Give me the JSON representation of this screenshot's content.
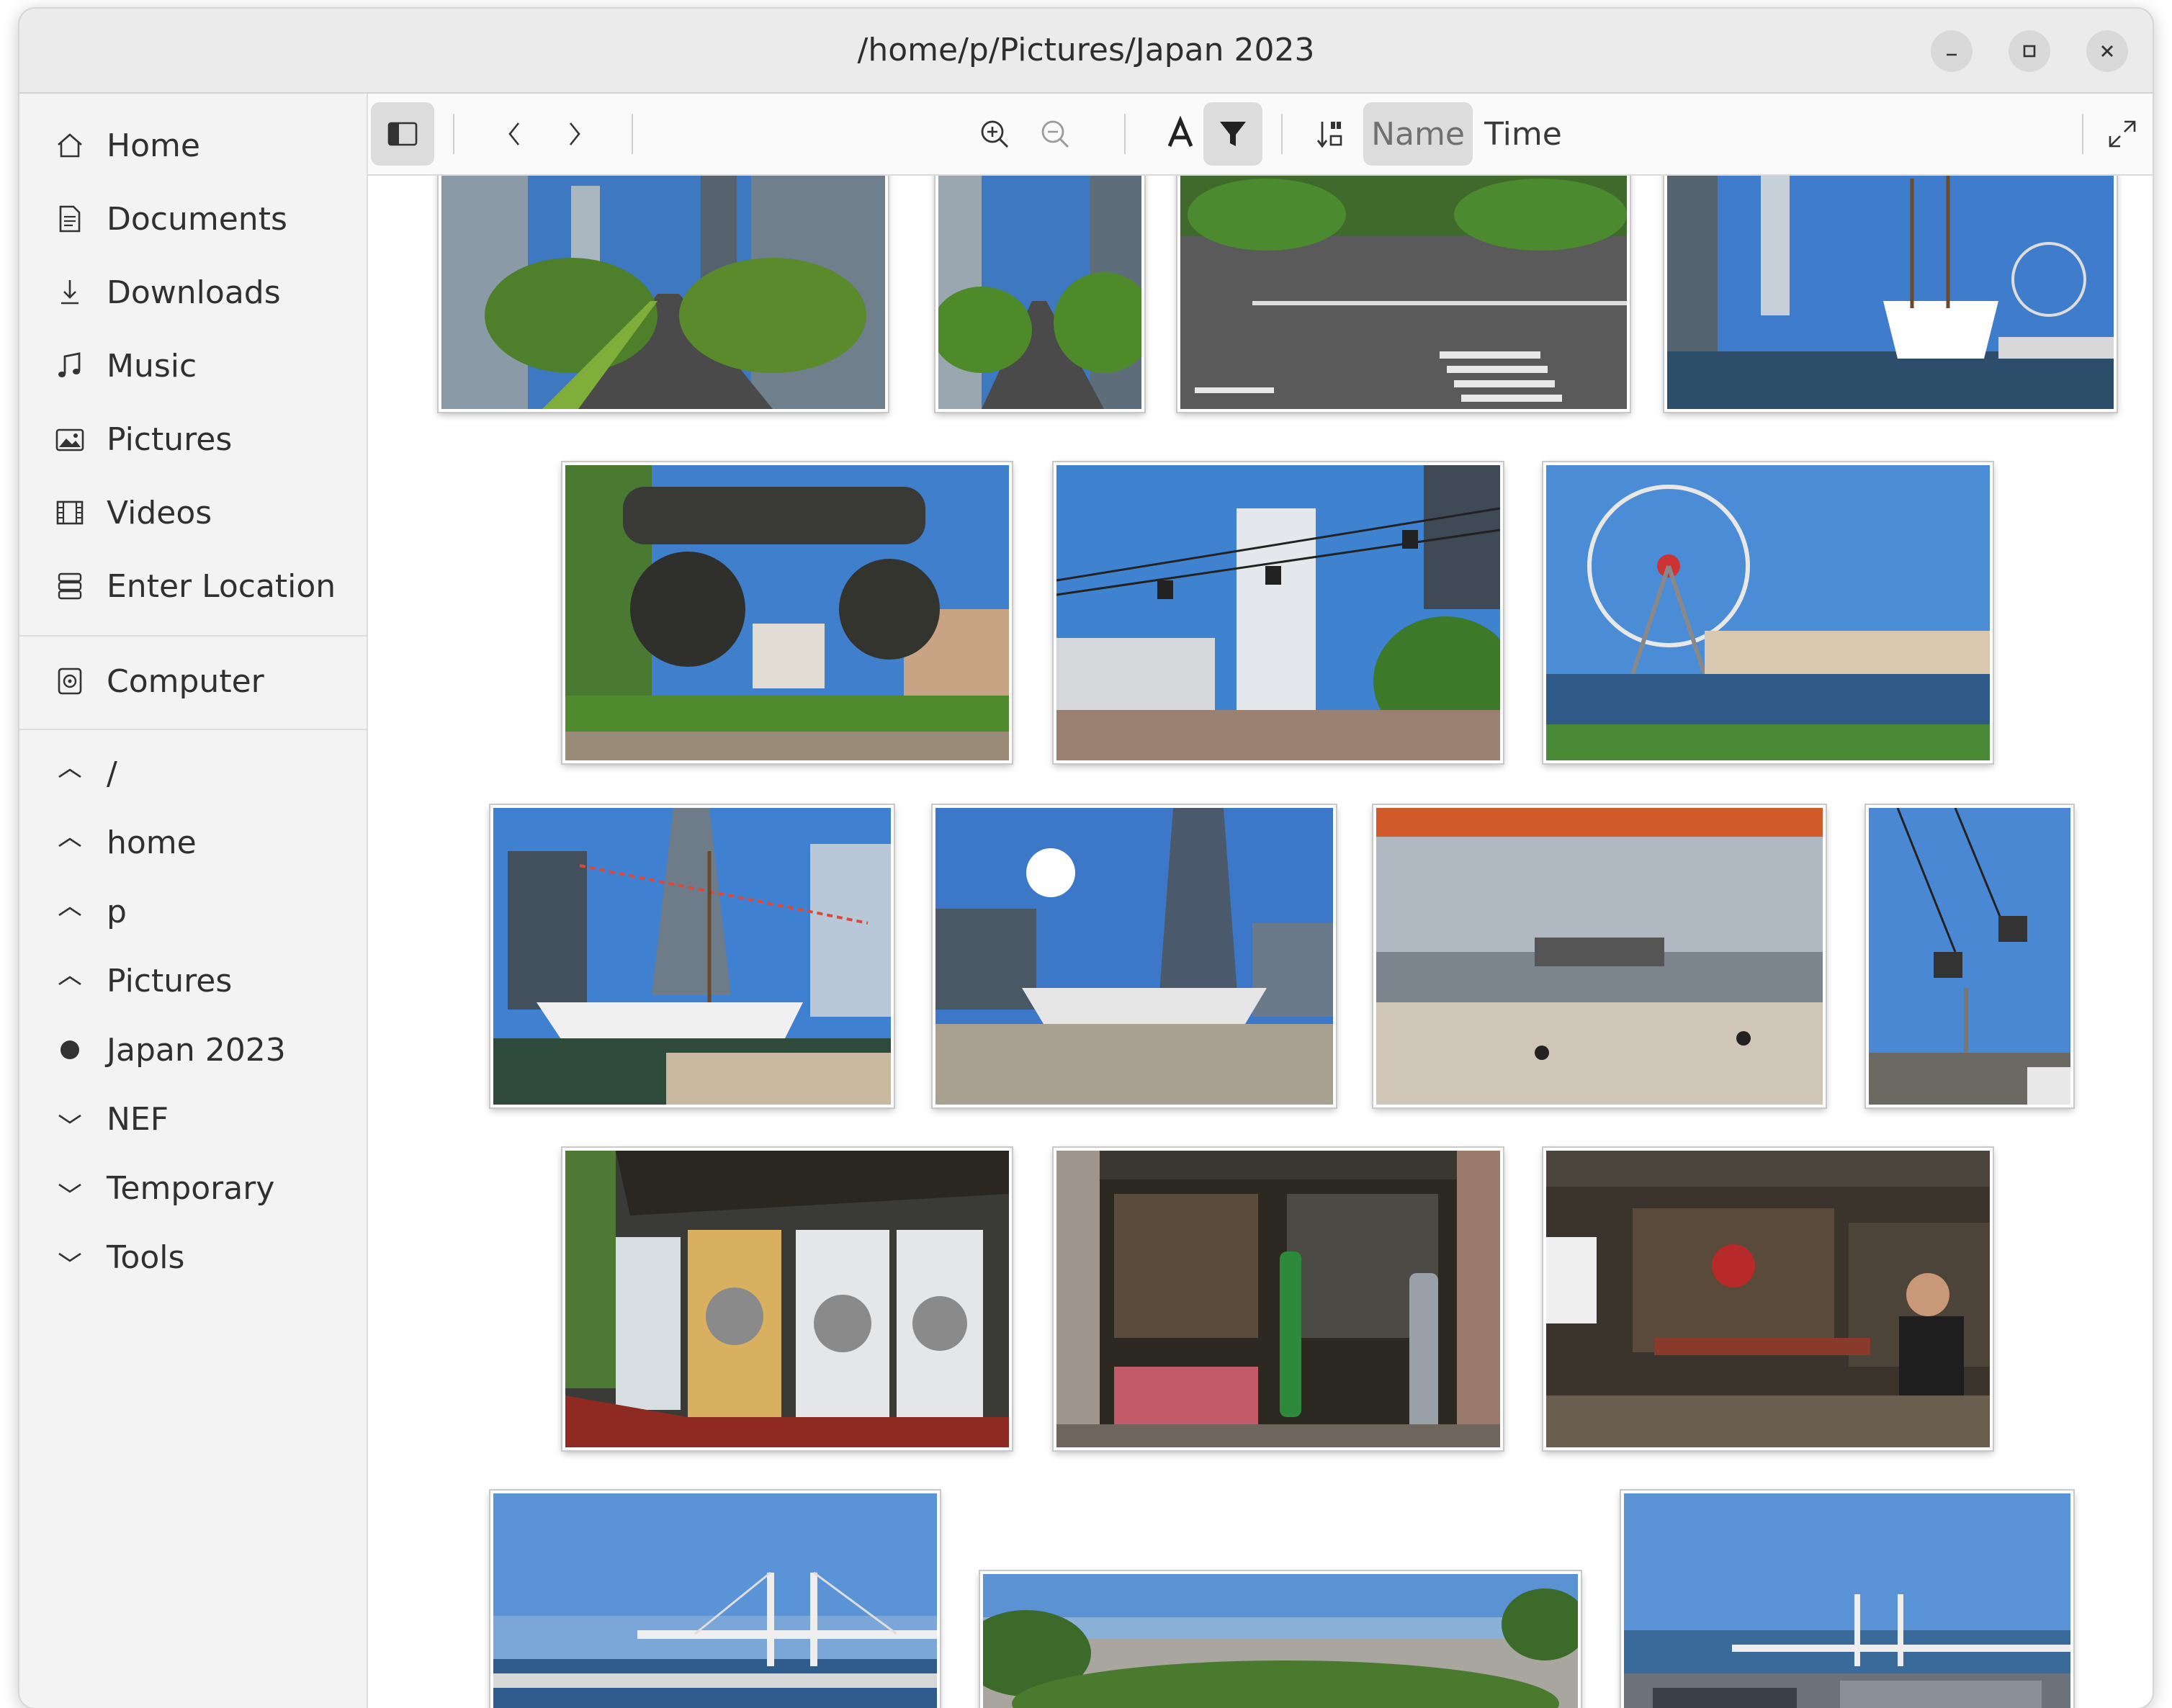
{
  "window": {
    "title": "/home/p/Pictures/Japan 2023"
  },
  "window_controls": [
    "minimize-icon",
    "maximize-icon",
    "close-icon"
  ],
  "sidebar": {
    "places": [
      {
        "label": "Home",
        "icon": "home-icon"
      },
      {
        "label": "Documents",
        "icon": "document-icon"
      },
      {
        "label": "Downloads",
        "icon": "download-icon"
      },
      {
        "label": "Music",
        "icon": "music-note-icon"
      },
      {
        "label": "Pictures",
        "icon": "picture-icon"
      },
      {
        "label": "Videos",
        "icon": "film-icon"
      },
      {
        "label": "Enter Location",
        "icon": "location-entry-icon"
      }
    ],
    "devices": [
      {
        "label": "Computer",
        "icon": "computer-disk-icon"
      }
    ],
    "tree": [
      {
        "label": "/",
        "icon": "chevron-up-icon"
      },
      {
        "label": "home",
        "icon": "chevron-up-icon"
      },
      {
        "label": "p",
        "icon": "chevron-up-icon"
      },
      {
        "label": "Pictures",
        "icon": "chevron-up-icon"
      },
      {
        "label": "Japan 2023",
        "icon": "current-folder-dot-icon"
      },
      {
        "label": "NEF",
        "icon": "chevron-down-icon"
      },
      {
        "label": "Temporary",
        "icon": "chevron-down-icon"
      },
      {
        "label": "Tools",
        "icon": "chevron-down-icon"
      }
    ]
  },
  "toolbar": {
    "sidebar_toggle_icon": "sidebar-toggle-icon",
    "back_icon": "chevron-left-icon",
    "forward_icon": "chevron-right-icon",
    "zoom_in_icon": "zoom-in-icon",
    "zoom_out_icon": "zoom-out-icon",
    "show_names_icon": "text-label-icon",
    "filter_icon": "filter-icon",
    "sort_order_icon": "sort-order-icon",
    "sort_name_label": "Name",
    "sort_time_label": "Time",
    "fullscreen_icon": "fullscreen-icon"
  },
  "colors": {
    "accent_active": "#dcdcdc",
    "sky": "#4a86c8",
    "titlebar": "#ebebeb"
  },
  "thumbnails": [
    {
      "subject": "city-avenue"
    },
    {
      "subject": "city-avenue-narrow"
    },
    {
      "subject": "street-crossing"
    },
    {
      "subject": "sailing-ship-harbor"
    },
    {
      "subject": "old-engine-monument"
    },
    {
      "subject": "cable-car-tower"
    },
    {
      "subject": "ferris-wheel-waterfront"
    },
    {
      "subject": "tall-ship-flags"
    },
    {
      "subject": "ship-plaza-sun"
    },
    {
      "subject": "ship-hull-plaza"
    },
    {
      "subject": "cable-car-sky"
    },
    {
      "subject": "laundromat"
    },
    {
      "subject": "workshop-store"
    },
    {
      "subject": "workshop-man"
    },
    {
      "subject": "bay-bridge"
    },
    {
      "subject": "city-panorama"
    },
    {
      "subject": "bay-bridge-port"
    }
  ]
}
